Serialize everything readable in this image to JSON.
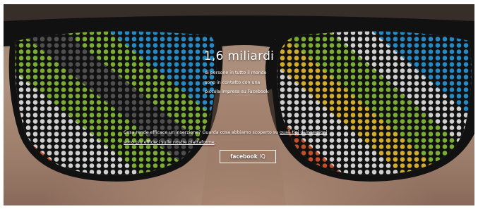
{
  "hero": {
    "stat_number": "1,6 miliardi",
    "stat_lines": [
      "di persone in tutto il mondo",
      "sono in contatto con una",
      "piccola impresa su Facebook"
    ],
    "question_text": "Cosa rende efficace un'inserzione? Guarda cosa abbiamo scoperto su ",
    "question_link": "quali tipi di inserzioni sono più efficaci sulle nostre piattaforme",
    "question_end": "."
  },
  "cta": {
    "brand": "facebook",
    "suffix": "IQ"
  },
  "colors": {
    "overlay_text": "#ffffff",
    "frame": "#141414",
    "stripes": [
      "#e0592c",
      "#ececec",
      "#8cc43c",
      "#2a9de0",
      "#f2c432"
    ]
  }
}
